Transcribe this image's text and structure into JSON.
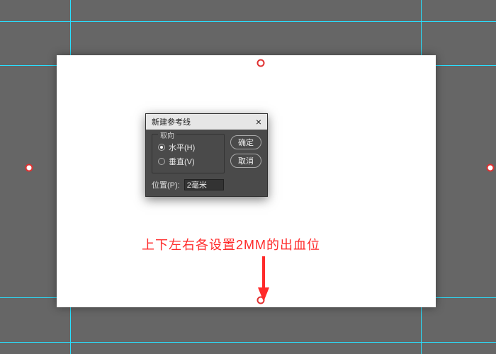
{
  "dialog": {
    "title": "新建参考线",
    "close": "×",
    "orientation_legend": "取向",
    "radio_h": "水平(H)",
    "radio_v": "垂直(V)",
    "ok": "确定",
    "cancel": "取消",
    "position_label": "位置(P):",
    "position_value": "2毫米"
  },
  "annotation": {
    "text": "上下左右各设置2MM的出血位"
  },
  "colors": {
    "guide": "#29e0ff",
    "handle": "#e03131",
    "annotation": "#ff2a2a"
  }
}
